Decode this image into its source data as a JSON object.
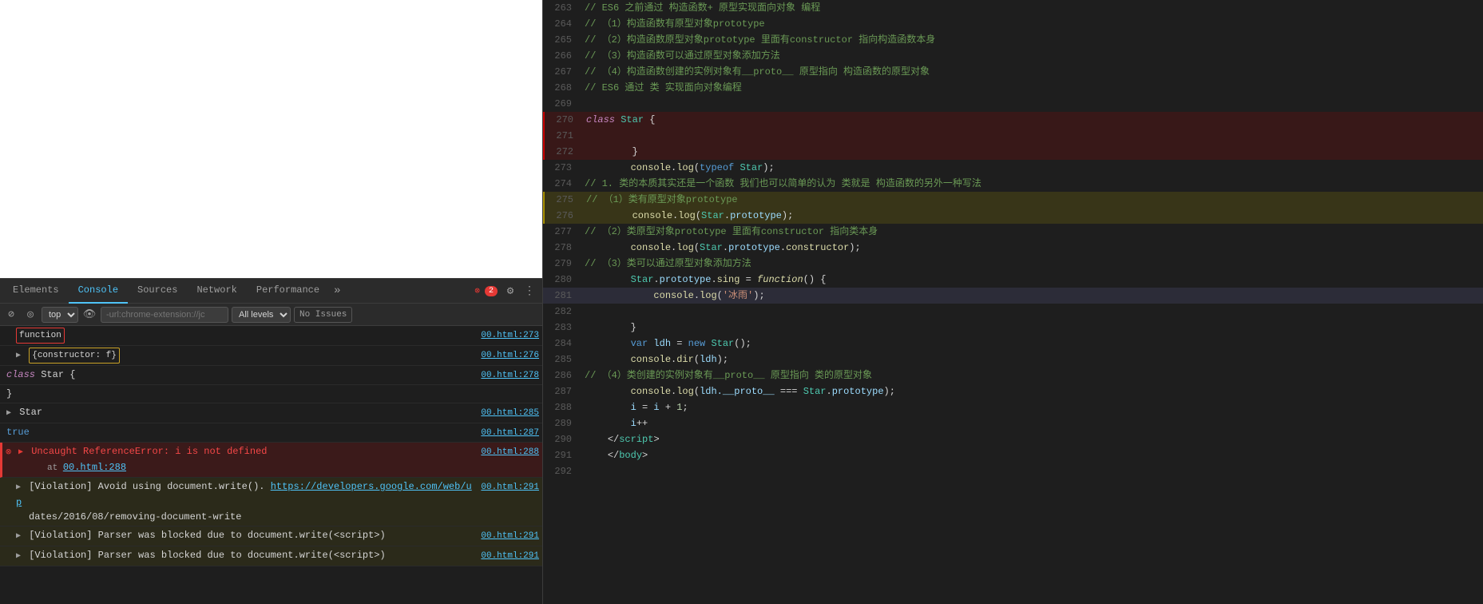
{
  "devtools": {
    "tabs": [
      {
        "label": "Elements",
        "active": false
      },
      {
        "label": "Console",
        "active": true
      },
      {
        "label": "Sources",
        "active": false
      },
      {
        "label": "Network",
        "active": false
      },
      {
        "label": "Performance",
        "active": false
      }
    ],
    "more_tabs_label": "»",
    "badge_count": "2",
    "toolbar": {
      "top_label": "top",
      "filter_placeholder": "-url:chrome-extension://jc",
      "levels_label": "All levels",
      "no_issues_label": "No Issues"
    },
    "console_rows": [
      {
        "type": "function",
        "content_type": "function-badge",
        "label": "function",
        "location": "00.html:273"
      },
      {
        "type": "object",
        "content_type": "object-badge",
        "label": "▶ {constructor: f}",
        "location": "00.html:276"
      },
      {
        "type": "normal",
        "content": "class Star {",
        "location": "00.html:278"
      },
      {
        "type": "normal",
        "content": "        }",
        "location": ""
      },
      {
        "type": "normal",
        "content": "▶ Star",
        "location": "00.html:285"
      },
      {
        "type": "normal",
        "content": "true",
        "location": "00.html:287"
      },
      {
        "type": "error",
        "content": "▶ Uncaught ReferenceError: i is not defined\n    at 00.html:288",
        "location": "00.html:288"
      },
      {
        "type": "violation",
        "content": "▶ [Violation] Avoid using document.write(). https://developers.google.com/web/up\ndates/2016/08/removing-document-write",
        "location": "00.html:291"
      },
      {
        "type": "violation",
        "content": "▶ [Violation] Parser was blocked due to document.write(<script>)",
        "location": "00.html:291"
      },
      {
        "type": "violation",
        "content": "▶ [Violation] Parser was blocked due to document.write(<script>)",
        "location": "00.html:291"
      }
    ]
  },
  "code": {
    "lines": [
      {
        "num": 263,
        "tokens": [
          {
            "type": "comment",
            "text": "// ES6 之前通过 构造函数+ 原型实现面向对象 编程"
          }
        ]
      },
      {
        "num": 264,
        "tokens": [
          {
            "type": "comment",
            "text": "// （1）构造函数有原型对象prototype"
          }
        ]
      },
      {
        "num": 265,
        "tokens": [
          {
            "type": "comment",
            "text": "// （2）构造函数原型对象prototype 里面有constructor 指向构造函数本身"
          }
        ]
      },
      {
        "num": 266,
        "tokens": [
          {
            "type": "comment",
            "text": "// （3）构造函数可以通过原型对象添加方法"
          }
        ]
      },
      {
        "num": 267,
        "tokens": [
          {
            "type": "comment",
            "text": "// （4）构造函数创建的实例对象有__proto__ 原型指向 构造函数的原型对象"
          }
        ]
      },
      {
        "num": 268,
        "tokens": [
          {
            "type": "comment",
            "text": "// ES6 通过 类 实现面向对象编程"
          }
        ]
      },
      {
        "num": 269,
        "tokens": []
      },
      {
        "num": 270,
        "highlight": "red",
        "tokens": [
          {
            "type": "kw-class",
            "text": "class"
          },
          {
            "type": "text",
            "text": " "
          },
          {
            "type": "klass",
            "text": "Star"
          },
          {
            "type": "punct",
            "text": " {"
          }
        ]
      },
      {
        "num": 271,
        "highlight": "red",
        "tokens": []
      },
      {
        "num": 272,
        "highlight": "red",
        "tokens": [
          {
            "type": "punct",
            "text": "        }"
          }
        ]
      },
      {
        "num": 273,
        "tokens": [
          {
            "type": "text",
            "text": "        "
          },
          {
            "type": "fn-name",
            "text": "console"
          },
          {
            "type": "punct",
            "text": "."
          },
          {
            "type": "fn-name",
            "text": "log"
          },
          {
            "type": "punct",
            "text": "("
          },
          {
            "type": "kw-typeof",
            "text": "typeof"
          },
          {
            "type": "text",
            "text": " "
          },
          {
            "type": "klass",
            "text": "Star"
          },
          {
            "type": "punct",
            "text": ");"
          }
        ]
      },
      {
        "num": 274,
        "tokens": [
          {
            "type": "comment",
            "text": "// 1. 类的本质其实还是一个函数 我们也可以简单的认为 类就是 构造函数的另外一种写法"
          }
        ]
      },
      {
        "num": 275,
        "highlight": "yellow",
        "tokens": [
          {
            "type": "comment",
            "text": "// （1）类有原型对象prototype"
          }
        ]
      },
      {
        "num": 276,
        "highlight": "yellow",
        "tokens": [
          {
            "type": "text",
            "text": "        "
          },
          {
            "type": "fn-name",
            "text": "console"
          },
          {
            "type": "punct",
            "text": "."
          },
          {
            "type": "fn-name",
            "text": "log"
          },
          {
            "type": "punct",
            "text": "("
          },
          {
            "type": "klass",
            "text": "Star"
          },
          {
            "type": "punct",
            "text": "."
          },
          {
            "type": "prop",
            "text": "prototype"
          },
          {
            "type": "punct",
            "text": ");"
          }
        ]
      },
      {
        "num": 277,
        "tokens": [
          {
            "type": "comment",
            "text": "// （2）类原型对象prototype 里面有constructor 指向类本身"
          }
        ]
      },
      {
        "num": 278,
        "tokens": [
          {
            "type": "text",
            "text": "        "
          },
          {
            "type": "fn-name",
            "text": "console"
          },
          {
            "type": "punct",
            "text": "."
          },
          {
            "type": "fn-name",
            "text": "log"
          },
          {
            "type": "punct",
            "text": "("
          },
          {
            "type": "klass",
            "text": "Star"
          },
          {
            "type": "punct",
            "text": "."
          },
          {
            "type": "prop",
            "text": "prototype"
          },
          {
            "type": "punct",
            "text": "."
          },
          {
            "type": "fn-name",
            "text": "constructor"
          },
          {
            "type": "punct",
            "text": ");"
          }
        ]
      },
      {
        "num": 279,
        "tokens": [
          {
            "type": "comment",
            "text": "// （3）类可以通过原型对象添加方法"
          }
        ]
      },
      {
        "num": 280,
        "tokens": [
          {
            "type": "klass",
            "text": "        Star"
          },
          {
            "type": "punct",
            "text": "."
          },
          {
            "type": "prop",
            "text": "prototype"
          },
          {
            "type": "punct",
            "text": "."
          },
          {
            "type": "fn-name",
            "text": "sing"
          },
          {
            "type": "punct",
            "text": " = "
          },
          {
            "type": "kw-function",
            "text": "function"
          },
          {
            "type": "punct",
            "text": "() {"
          }
        ]
      },
      {
        "num": 281,
        "current": true,
        "tokens": [
          {
            "type": "text",
            "text": "            "
          },
          {
            "type": "fn-name",
            "text": "console"
          },
          {
            "type": "punct",
            "text": "."
          },
          {
            "type": "fn-name",
            "text": "log"
          },
          {
            "type": "punct",
            "text": "("
          },
          {
            "type": "string",
            "text": "'冰雨'"
          },
          {
            "type": "punct",
            "text": ");"
          }
        ]
      },
      {
        "num": 282,
        "tokens": []
      },
      {
        "num": 283,
        "tokens": [
          {
            "type": "punct",
            "text": "        }"
          }
        ]
      },
      {
        "num": 284,
        "tokens": [
          {
            "type": "kw-var",
            "text": "        var"
          },
          {
            "type": "text",
            "text": " "
          },
          {
            "type": "prop",
            "text": "ldh"
          },
          {
            "type": "punct",
            "text": " = "
          },
          {
            "type": "kw-new",
            "text": "new"
          },
          {
            "type": "text",
            "text": " "
          },
          {
            "type": "klass",
            "text": "Star"
          },
          {
            "type": "punct",
            "text": "();"
          }
        ]
      },
      {
        "num": 285,
        "tokens": [
          {
            "type": "fn-name",
            "text": "        console"
          },
          {
            "type": "punct",
            "text": "."
          },
          {
            "type": "fn-name",
            "text": "dir"
          },
          {
            "type": "punct",
            "text": "("
          },
          {
            "type": "prop",
            "text": "ldh"
          },
          {
            "type": "punct",
            "text": ");"
          }
        ]
      },
      {
        "num": 286,
        "tokens": [
          {
            "type": "comment",
            "text": "// （4）类创建的实例对象有__proto__ 原型指向 类的原型对象"
          }
        ]
      },
      {
        "num": 287,
        "tokens": [
          {
            "type": "fn-name",
            "text": "        console"
          },
          {
            "type": "punct",
            "text": "."
          },
          {
            "type": "fn-name",
            "text": "log"
          },
          {
            "type": "punct",
            "text": "("
          },
          {
            "type": "prop",
            "text": "ldh.__proto__"
          },
          {
            "type": "punct",
            "text": " === "
          },
          {
            "type": "klass",
            "text": "Star"
          },
          {
            "type": "punct",
            "text": "."
          },
          {
            "type": "prop",
            "text": "prototype"
          },
          {
            "type": "punct",
            "text": ");"
          }
        ]
      },
      {
        "num": 288,
        "tokens": [
          {
            "type": "text",
            "text": "        "
          },
          {
            "type": "prop",
            "text": "i"
          },
          {
            "type": "punct",
            "text": " = "
          },
          {
            "type": "prop",
            "text": "i"
          },
          {
            "type": "punct",
            "text": " + "
          },
          {
            "type": "num",
            "text": "1"
          },
          {
            "type": "punct",
            "text": ";"
          }
        ]
      },
      {
        "num": 289,
        "tokens": [
          {
            "type": "text",
            "text": "        "
          },
          {
            "type": "prop",
            "text": "i"
          },
          {
            "type": "punct",
            "text": "++"
          }
        ]
      },
      {
        "num": 290,
        "tokens": [
          {
            "type": "text",
            "text": "    "
          },
          {
            "type": "punct",
            "text": "</"
          },
          {
            "type": "klass",
            "text": "script"
          },
          {
            "type": "punct",
            "text": ">"
          }
        ]
      },
      {
        "num": 291,
        "tokens": [
          {
            "type": "text",
            "text": "    "
          },
          {
            "type": "punct",
            "text": "</"
          },
          {
            "type": "klass",
            "text": "body"
          },
          {
            "type": "punct",
            "text": ">"
          }
        ]
      },
      {
        "num": 292,
        "tokens": []
      }
    ]
  }
}
